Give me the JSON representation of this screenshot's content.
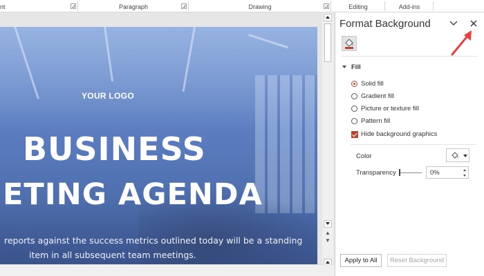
{
  "ribbon": {
    "groups": [
      {
        "label": "nt"
      },
      {
        "label": "Paragraph"
      },
      {
        "label": "Drawing"
      },
      {
        "label": "Editing"
      },
      {
        "label": "Add-ins"
      }
    ]
  },
  "slide": {
    "logo": "YOUR LOGO",
    "title_line1": "BUSINESS",
    "title_line2": "ETING AGENDA",
    "body_line1": "reports against the success metrics outlined today will be a standing",
    "body_line2": "item in all subsequent team meetings."
  },
  "pane": {
    "title": "Format Background",
    "section": "Fill",
    "options": [
      {
        "label": "Solid fill",
        "selected": true
      },
      {
        "label": "Gradient fill",
        "selected": false
      },
      {
        "label": "Picture or texture fill",
        "selected": false
      },
      {
        "label": "Pattern fill",
        "selected": false
      }
    ],
    "hide_graphics_label": "Hide background graphics",
    "hide_graphics_checked": true,
    "color_label": "Color",
    "transparency_label": "Transparency",
    "transparency_value": "0%",
    "apply_all": "Apply to All",
    "reset_background": "Reset Background"
  },
  "colors": {
    "accent": "#b5472f",
    "slide_overlay": "#5d7fc2",
    "annotation_arrow": "#e8403a"
  },
  "icons": {
    "pane_menu": "chevron-down-icon",
    "pane_close": "close-icon",
    "fill_tab": "paint-bucket-icon",
    "color_picker": "paint-bucket-icon"
  }
}
